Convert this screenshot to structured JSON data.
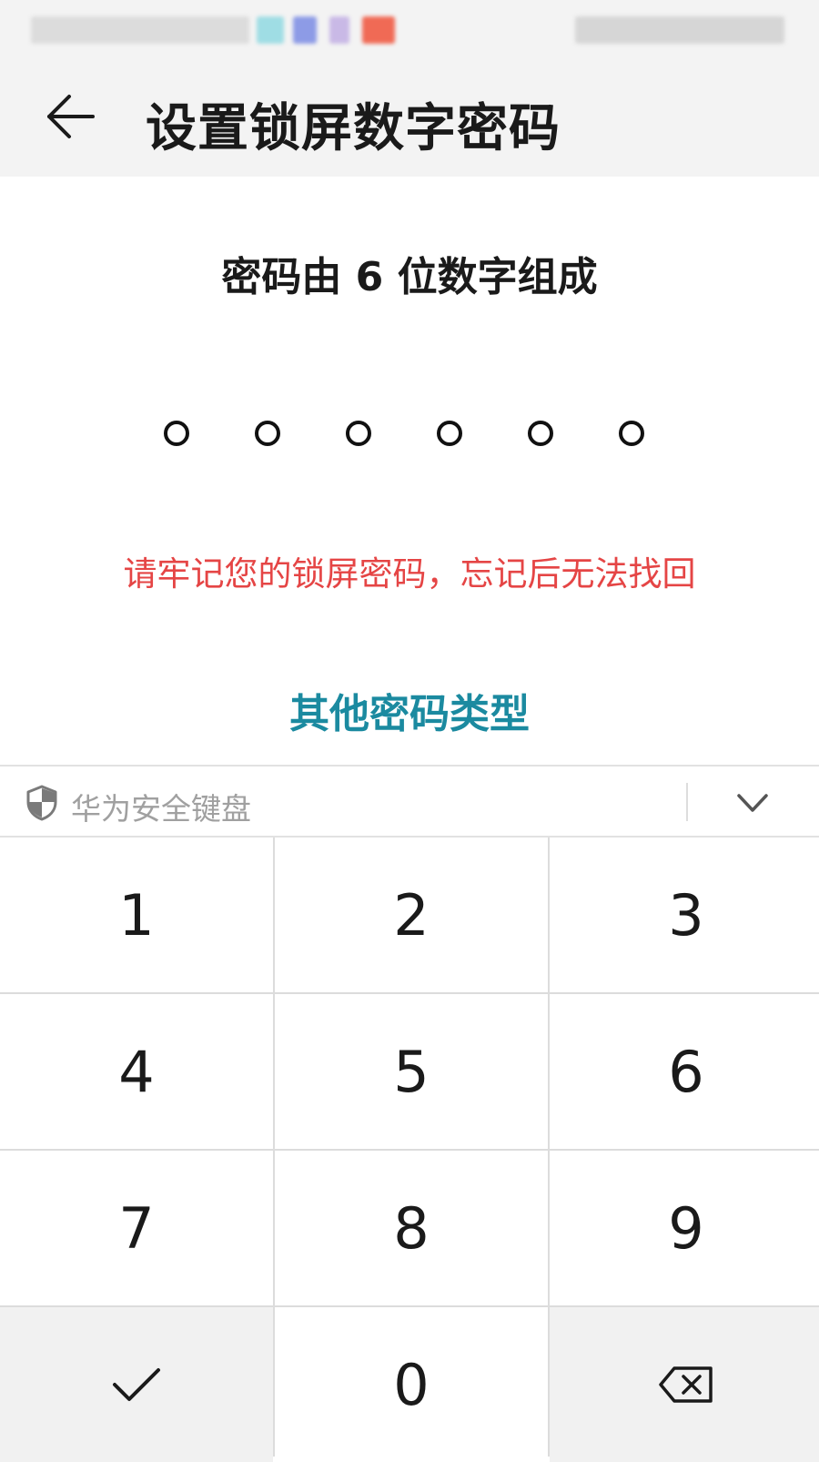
{
  "header": {
    "title": "设置锁屏数字密码",
    "back_icon": "arrow-left-icon"
  },
  "main": {
    "subtitle": "密码由 6 位数字组成",
    "pin_length": 6,
    "pin_entered": 0,
    "warning": "请牢记您的锁屏密码，忘记后无法找回",
    "other_types": "其他密码类型"
  },
  "keyboard": {
    "label": "华为安全键盘",
    "shield_icon": "shield-icon",
    "collapse_icon": "chevron-down-icon",
    "keys": [
      "1",
      "2",
      "3",
      "4",
      "5",
      "6",
      "7",
      "8",
      "9"
    ],
    "zero": "0",
    "confirm_icon": "check-icon",
    "delete_icon": "backspace-icon"
  },
  "colors": {
    "warning": "#e54545",
    "link": "#1b8aa0",
    "header_bg": "#f3f3f3"
  }
}
